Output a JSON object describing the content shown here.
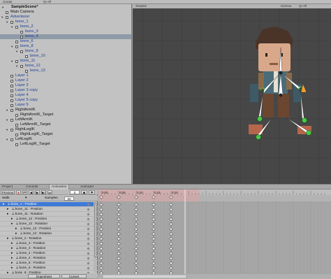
{
  "top_bar": {
    "create_label": "Create",
    "all_label": "Q+All"
  },
  "scene_bar": {
    "shaded_label": "Shaded",
    "gizmos_label": "Gizmos",
    "all_label": "Q+All"
  },
  "hierarchy": {
    "scene_name": "SampleScene*",
    "items": [
      {
        "label": "Main Camera",
        "indent": 0,
        "blue": false
      },
      {
        "label": "Adventurer",
        "indent": 0,
        "blue": true,
        "arrow": "▾"
      },
      {
        "label": "bone_1",
        "indent": 1,
        "blue": true,
        "arrow": "▾"
      },
      {
        "label": "bone_2",
        "indent": 2,
        "blue": true,
        "arrow": "▾"
      },
      {
        "label": "bone_3",
        "indent": 3,
        "blue": true
      },
      {
        "label": "bone_4",
        "indent": 3,
        "blue": true,
        "selected": true
      },
      {
        "label": "bone_6",
        "indent": 2,
        "blue": true
      },
      {
        "label": "bone_8",
        "indent": 2,
        "blue": true,
        "arrow": "▾"
      },
      {
        "label": "bone_9",
        "indent": 3,
        "blue": true,
        "arrow": "▾"
      },
      {
        "label": "bone_10",
        "indent": 4,
        "blue": true
      },
      {
        "label": "bone_11",
        "indent": 2,
        "blue": true,
        "arrow": "▾"
      },
      {
        "label": "bone_12",
        "indent": 3,
        "blue": true,
        "arrow": "▾"
      },
      {
        "label": "bone_13",
        "indent": 4,
        "blue": true
      },
      {
        "label": "Layer 1",
        "indent": 1,
        "blue": true
      },
      {
        "label": "Layer 2",
        "indent": 1,
        "blue": true
      },
      {
        "label": "Layer 3",
        "indent": 1,
        "blue": true
      },
      {
        "label": "Layer 3 copy",
        "indent": 1,
        "blue": true
      },
      {
        "label": "Layer 4",
        "indent": 1,
        "blue": true
      },
      {
        "label": "Layer 5 copy",
        "indent": 1,
        "blue": true
      },
      {
        "label": "Layer 5",
        "indent": 1,
        "blue": true
      },
      {
        "label": "RightArmIK",
        "indent": 1,
        "blue": false,
        "arrow": "▾"
      },
      {
        "label": "RightArmIK_Target",
        "indent": 2,
        "blue": false
      },
      {
        "label": "LeftArmIK",
        "indent": 1,
        "blue": false,
        "arrow": "▾"
      },
      {
        "label": "LeftArmIK_Target",
        "indent": 2,
        "blue": false
      },
      {
        "label": "RightLegIK",
        "indent": 1,
        "blue": false,
        "arrow": "▾"
      },
      {
        "label": "RightLegIK_Target",
        "indent": 2,
        "blue": false
      },
      {
        "label": "LeftLegIK",
        "indent": 1,
        "blue": false,
        "arrow": "▾"
      },
      {
        "label": "LeftLegIK_Target",
        "indent": 2,
        "blue": false
      }
    ]
  },
  "tabs": [
    {
      "label": "Project",
      "icon": "folder-icon"
    },
    {
      "label": "Console",
      "icon": "console-icon"
    },
    {
      "label": "Animation",
      "icon": "animation-icon",
      "active": true
    },
    {
      "label": "Animator",
      "icon": "animator-icon"
    }
  ],
  "animation": {
    "preview_label": "Preview",
    "frame_value": "0",
    "clip_name": "Walk",
    "samples_label": "Samples",
    "samples_value": "60",
    "properties": [
      {
        "label": "bone_1 : Position",
        "indent": 0,
        "selected": true
      },
      {
        "label": "bone_11 : Position",
        "indent": 1
      },
      {
        "label": "bone_11 : Rotation",
        "indent": 1
      },
      {
        "label": "bone_12 : Position",
        "indent": 2
      },
      {
        "label": "bone_12 : Rotation",
        "indent": 2
      },
      {
        "label": "bone_13 : Position",
        "indent": 3
      },
      {
        "label": "bone_13 : Rotation",
        "indent": 3
      },
      {
        "label": "bone_2 : Rotation",
        "indent": 1
      },
      {
        "label": "bone_3 : Position",
        "indent": 2
      },
      {
        "label": "bone_3 : Rotation",
        "indent": 2
      },
      {
        "label": "bone_4 : Position",
        "indent": 2
      },
      {
        "label": "bone_4 : Rotation",
        "indent": 2
      },
      {
        "label": "bone_6 : Position",
        "indent": 2
      },
      {
        "label": "bone_6 : Rotation",
        "indent": 2
      },
      {
        "label": "bone_8 : Position",
        "indent": 1
      }
    ],
    "timeline_labels": [
      "0:00",
      "0:05",
      "0:10",
      "0:15",
      "0:20"
    ],
    "keyframe_columns": [
      0,
      5,
      10,
      15,
      20
    ],
    "dopesheet_label": "Dopesheet",
    "curves_label": "Curves"
  },
  "colors": {
    "selection": "#3e7ad6",
    "scene_bg": "#474747",
    "recording": "#e0a0a0",
    "bone": "#ffffff",
    "ik_handle": "#44cc44"
  }
}
